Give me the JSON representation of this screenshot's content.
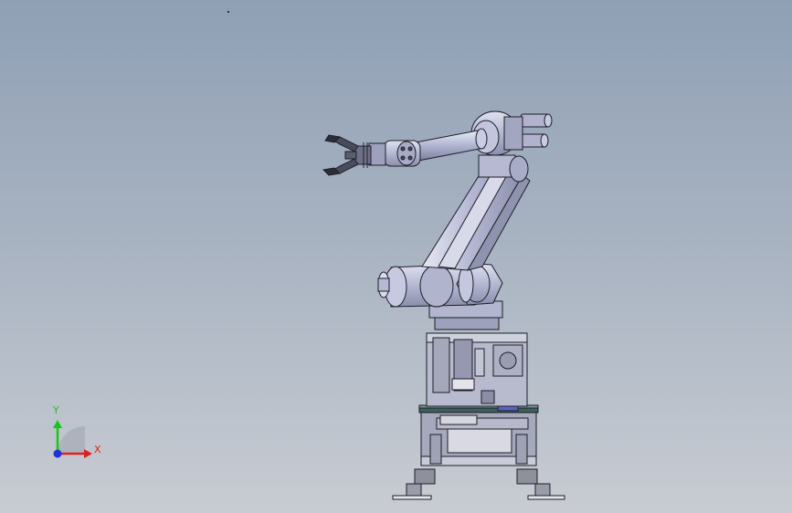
{
  "viewport": {
    "background_top": "#8fa0b5",
    "background_bottom": "#c8ccd2"
  },
  "model": {
    "icon": "robot-arm-assembly",
    "body_color": "#b9bdd6",
    "edge_color": "#1e1e28"
  },
  "triad": {
    "x_label": "X",
    "y_label": "Y",
    "x_color": "#e02020",
    "y_color": "#20c020",
    "z_color": "#2030e0"
  }
}
